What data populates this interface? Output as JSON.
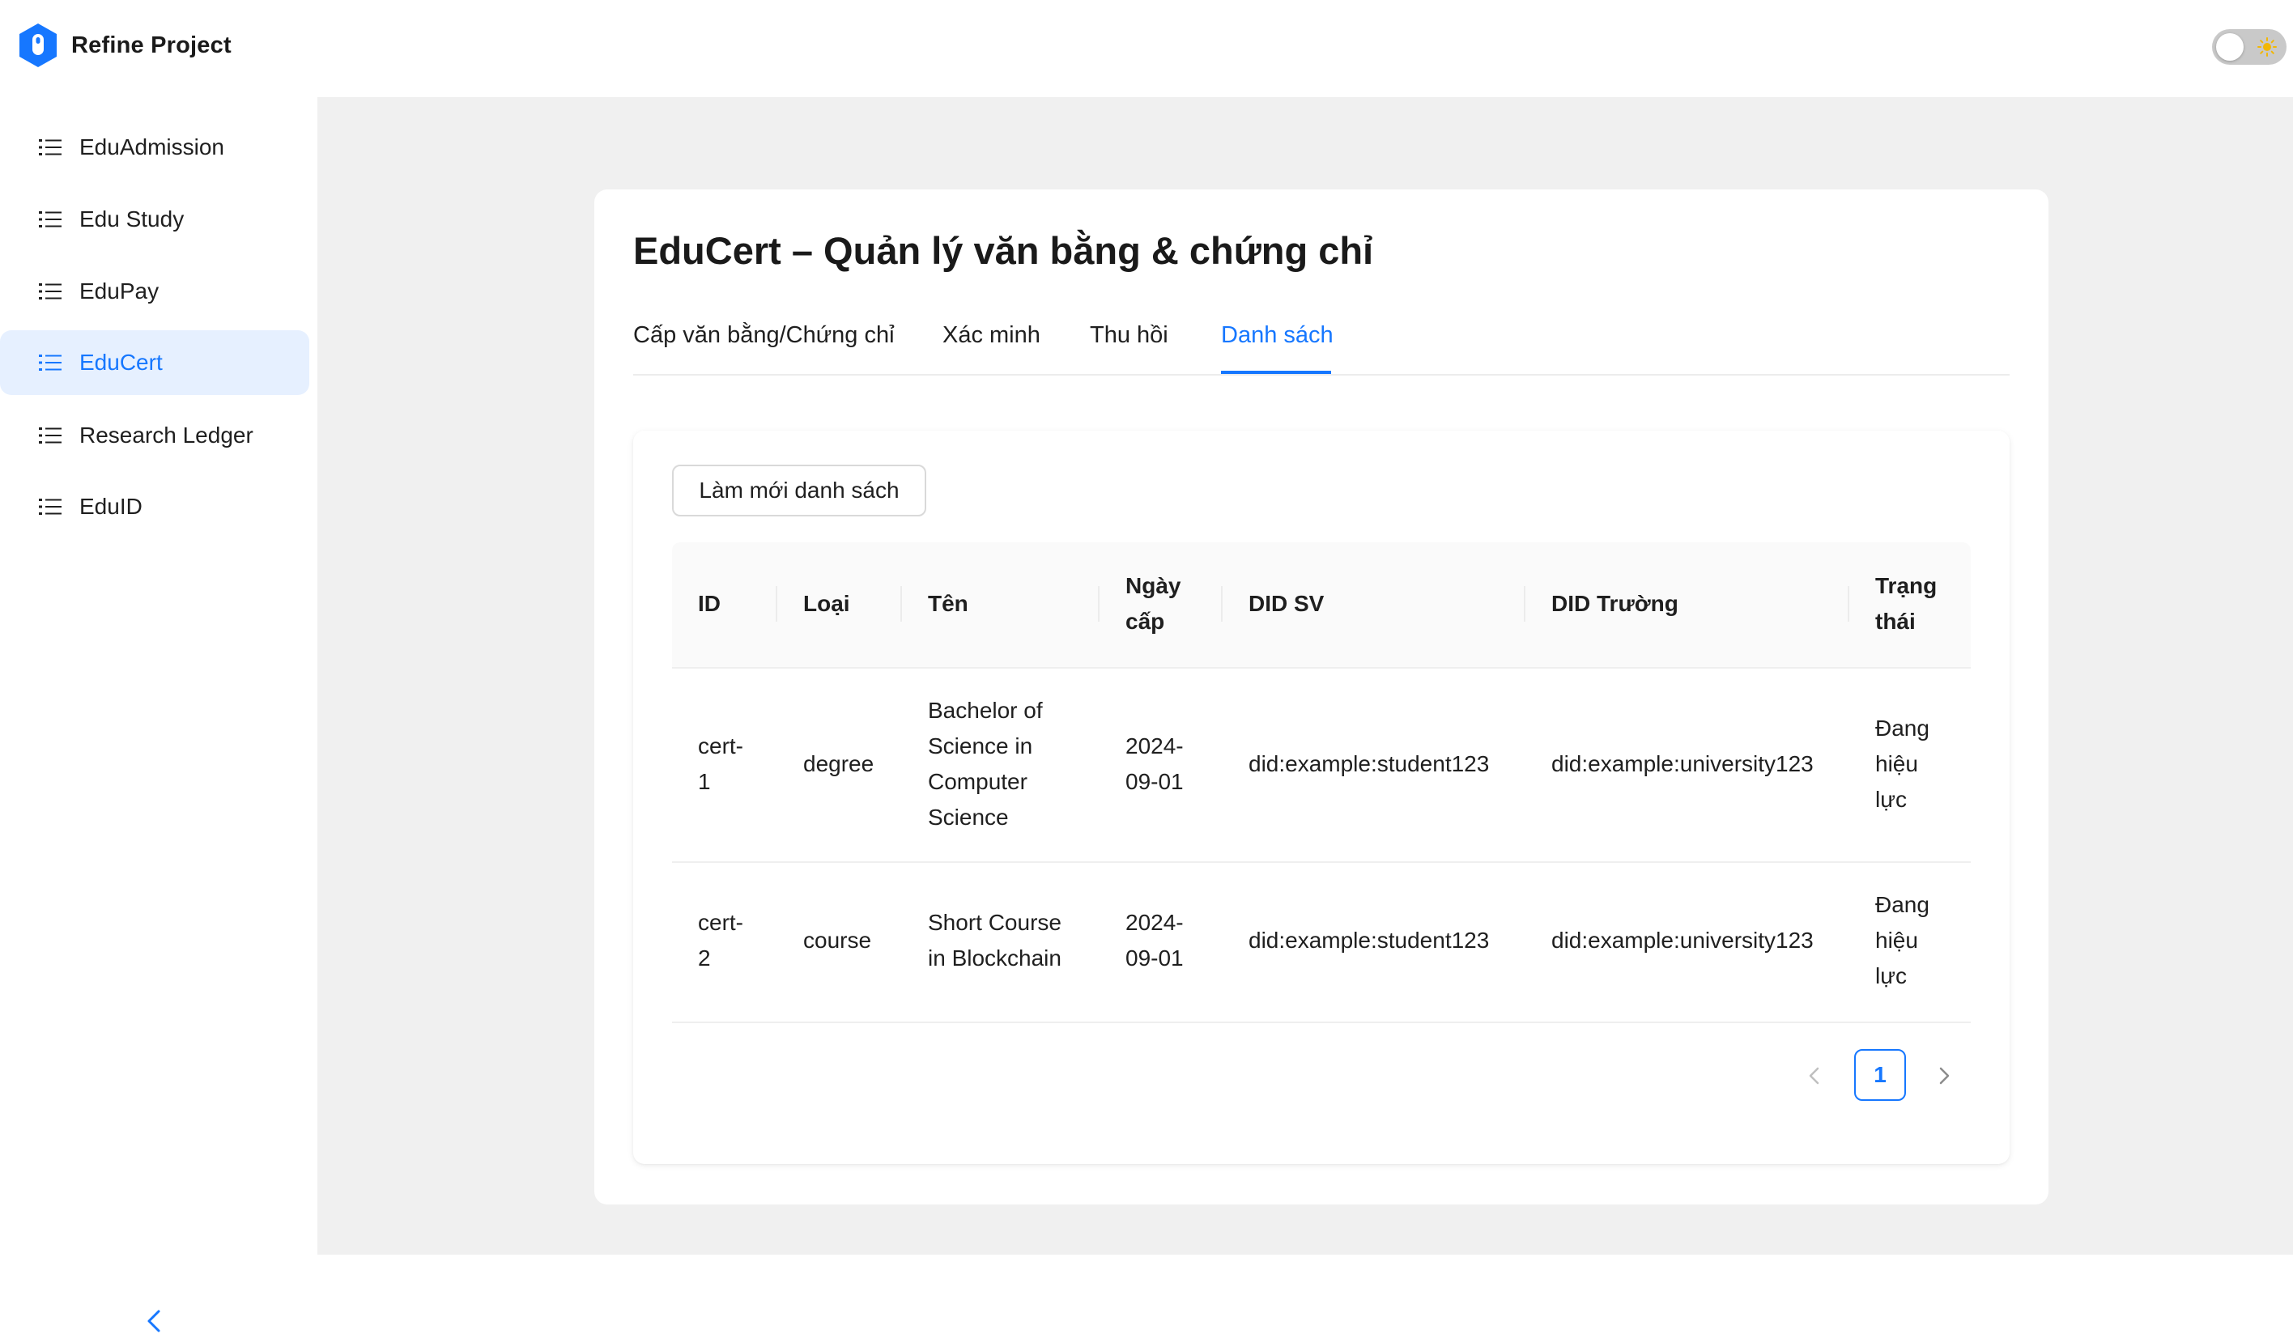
{
  "app": {
    "name": "Refine Project"
  },
  "header": {
    "theme_toggle_icon": "sun-icon"
  },
  "sidebar": {
    "items": [
      {
        "label": "EduAdmission",
        "icon": "list-icon",
        "active": false
      },
      {
        "label": "Edu Study",
        "icon": "list-icon",
        "active": false
      },
      {
        "label": "EduPay",
        "icon": "list-icon",
        "active": false
      },
      {
        "label": "EduCert",
        "icon": "list-icon",
        "active": true
      },
      {
        "label": "Research Ledger",
        "icon": "list-icon",
        "active": false
      },
      {
        "label": "EduID",
        "icon": "list-icon",
        "active": false
      }
    ],
    "collapse_icon": "chevron-left-icon"
  },
  "page": {
    "title": "EduCert – Quản lý văn bằng & chứng chỉ",
    "tabs": [
      {
        "label": "Cấp văn bằng/Chứng chỉ",
        "active": false
      },
      {
        "label": "Xác minh",
        "active": false
      },
      {
        "label": "Thu hồi",
        "active": false
      },
      {
        "label": "Danh sách",
        "active": true
      }
    ],
    "refresh_label": "Làm mới danh sách"
  },
  "table": {
    "columns": [
      {
        "lines": [
          "ID"
        ]
      },
      {
        "lines": [
          "Loại"
        ]
      },
      {
        "lines": [
          "Tên"
        ]
      },
      {
        "lines": [
          "Ngày",
          "cấp"
        ]
      },
      {
        "lines": [
          "DID SV"
        ]
      },
      {
        "lines": [
          "DID Trường"
        ]
      },
      {
        "lines": [
          "Trạng",
          "thái"
        ]
      }
    ],
    "rows": [
      {
        "id": [
          "cert-",
          "1"
        ],
        "type": [
          "degree"
        ],
        "name": [
          "Bachelor of",
          "Science in",
          "Computer",
          "Science"
        ],
        "date": [
          "2024-",
          "09-01"
        ],
        "did_sv": [
          "did:example:student123"
        ],
        "did_school": [
          "did:example:university123"
        ],
        "status": [
          "Đang",
          "hiệu",
          "lực"
        ]
      },
      {
        "id": [
          "cert-",
          "2"
        ],
        "type": [
          "course"
        ],
        "name": [
          "Short Course",
          "in Blockchain"
        ],
        "date": [
          "2024-",
          "09-01"
        ],
        "did_sv": [
          "did:example:student123"
        ],
        "did_school": [
          "did:example:university123"
        ],
        "status": [
          "Đang",
          "hiệu",
          "lực"
        ]
      }
    ]
  },
  "pagination": {
    "current_page": "1",
    "prev_icon": "chevron-left-icon",
    "next_icon": "chevron-right-icon"
  },
  "colors": {
    "accent": "#1677ff",
    "active_bg": "#e6f0ff",
    "content_bg": "#f0f0f0"
  }
}
